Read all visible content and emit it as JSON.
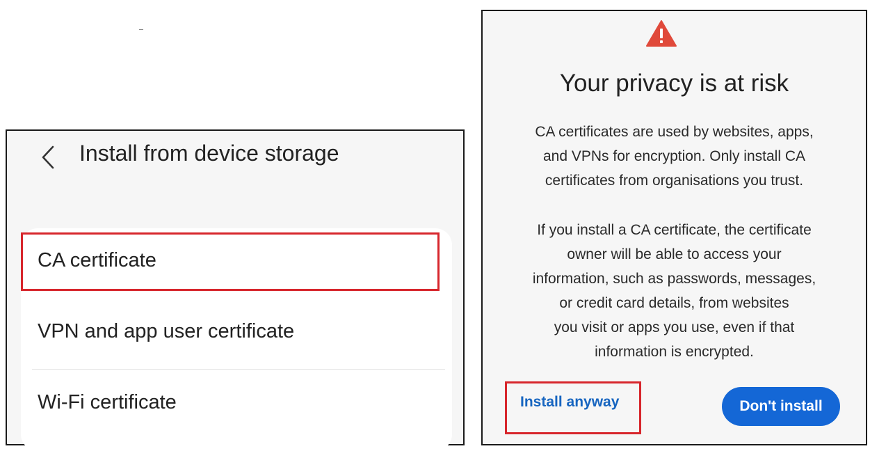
{
  "left_screen": {
    "header": {
      "title": "Install from device storage",
      "back_icon": "chevron-left-icon"
    },
    "items": [
      {
        "label": "CA certificate"
      },
      {
        "label": "VPN and app user certificate"
      },
      {
        "label": "Wi-Fi certificate"
      }
    ]
  },
  "dialog": {
    "icon": "warning-triangle-icon",
    "title": "Your privacy is at risk",
    "paragraph1": "CA certificates are used by websites, apps,\nand VPNs for encryption. Only install CA\ncertificates from organisations you trust.",
    "paragraph2": "If you install a CA certificate, the certificate\nowner will be able to access your\ninformation, such as passwords, messages,\nor credit card details, from websites\nyou visit or apps you use, even if that\ninformation is encrypted.",
    "install_anyway_label": "Install anyway",
    "dont_install_label": "Don't install"
  },
  "colors": {
    "highlight": "#d7262c",
    "accent": "#1467d6",
    "link": "#1765c0",
    "warning": "#e0493a"
  }
}
